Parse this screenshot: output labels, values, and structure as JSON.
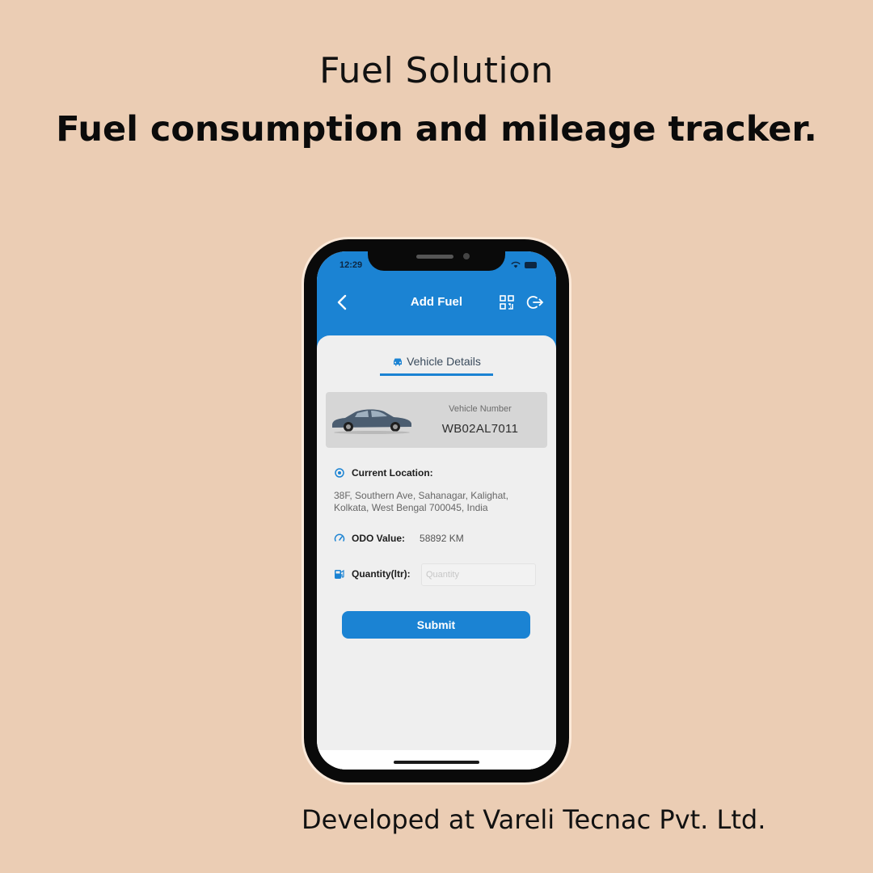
{
  "marketing": {
    "headline": "Fuel Solution",
    "subheadline": "Fuel consumption and mileage tracker.",
    "credit": "Developed at Vareli Tecnac Pvt. Ltd."
  },
  "status_bar": {
    "time": "12:29"
  },
  "header": {
    "title": "Add Fuel",
    "back_icon": "chevron-left-icon",
    "scan_icon": "qr-scan-icon",
    "logout_icon": "logout-icon"
  },
  "tabs": [
    {
      "label": "Vehicle Details",
      "icon": "car-icon",
      "active": true
    }
  ],
  "vehicle": {
    "number_label": "Vehicle Number",
    "number": "WB02AL7011"
  },
  "location": {
    "label": "Current Location:",
    "address_line1": "38F, Southern Ave, Sahanagar, Kalighat,",
    "address_line2": "Kolkata, West Bengal 700045, India"
  },
  "odo": {
    "label": "ODO Value:",
    "value": "58892 KM"
  },
  "quantity": {
    "label": "Quantity(ltr):",
    "placeholder": "Quantity",
    "value": ""
  },
  "submit_label": "Submit",
  "colors": {
    "primary": "#1b83d3",
    "background": "#ebcdb4"
  }
}
